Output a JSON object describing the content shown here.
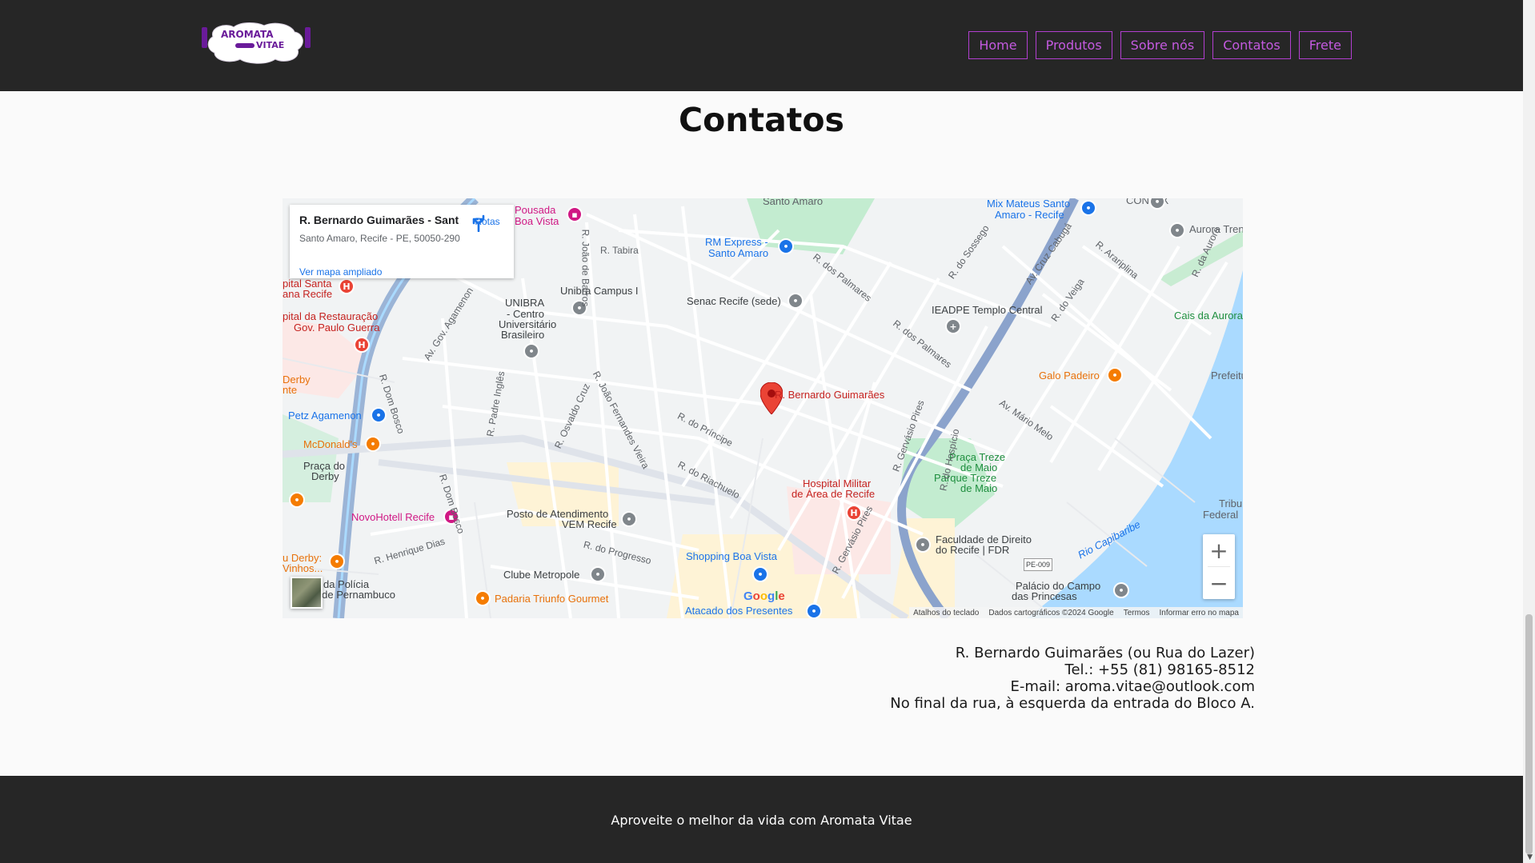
{
  "header": {
    "logo": {
      "line1": "AROMATA",
      "line2": "VITAE"
    },
    "nav": [
      {
        "label": "Home"
      },
      {
        "label": "Produtos"
      },
      {
        "label": "Sobre nós"
      },
      {
        "label": "Contatos"
      },
      {
        "label": "Frete"
      }
    ],
    "colors": {
      "background": "#262626",
      "accent": "#b23fd0"
    }
  },
  "main": {
    "title": "Contatos",
    "map": {
      "info_card": {
        "title": "R. Bernardo Guimarães - Sant...",
        "address": "Santo Amaro, Recife - PE, 50050-290",
        "directions_label": "Rotas",
        "larger_map_link": "Ver mapa ampliado"
      },
      "pin_label": "R. Bernardo Guimarães",
      "labels": [
        "Santo Amaro",
        "Pousada",
        "Boa Vista",
        "R. Tabira",
        "RM Express -",
        "Santo Amaro",
        "Mix Mateus Santo",
        "Amaro - Recife",
        "CONTAX",
        "Aurora Trend",
        "R. do Sossego",
        "Av. Cruz Cabugá",
        "R. Arariplina",
        "R. da Aurora",
        "Cais da Aurora",
        "Prefeitu",
        "Galo Padeiro",
        "IEADPE Templo Central",
        "R. do Veiga",
        "R. dos Palmares",
        "Senac Recife (sede)",
        "Unibra Campus I",
        "UNIBRA",
        "- Centro",
        "Universitário",
        "Brasileiro",
        "R. João de Barros",
        "pital Santa",
        "ana Recife",
        "pital da Restauração",
        "Gov. Paulo Guerra",
        "Derby",
        "nte",
        "Petz Agamenon",
        "McDonald's",
        "Praça do",
        "Derby",
        "NovoHotell Recife",
        "Posto de Atendimento",
        "VEM Recife",
        "Clube Metropole",
        "Shopping Boa Vista",
        "Padaria Triunfo Gourmet",
        "Atacado dos Presentes",
        "Hospital Militar",
        "de Área de Recife",
        "Praça Treze",
        "de Maio",
        "Parque Treze",
        "de Maio",
        "Faculdade de Direito",
        "do Recife | FDR",
        "Palácio do Campo",
        "das Princesas",
        "Rio Capibaribe",
        "Tribu",
        "Federal",
        "R. do Príncipe",
        "R. do Riachuelo",
        "R. do Progresso",
        "R. Henrique Dias",
        "R. Dom Bosco",
        "R. Padre Inglês",
        "R. Osvaldo Cruz",
        "R. João Fernandes Vieira",
        "Av. Gov. Agamenon",
        "R. Gervásio Pires",
        "R. do Hospício",
        "Av. Mário Melo",
        "u Derby:",
        "Vinhos...",
        "gio da Polícia",
        "ar de Pernambuco",
        "PE-009"
      ],
      "attribution": [
        "Atalhos do teclado",
        "Dados cartográficos ©2024 Google",
        "Termos",
        "Informar erro no mapa"
      ],
      "google_logo": "Google",
      "zoom_in": "+",
      "zoom_out": "−"
    },
    "address_lines": [
      "R. Bernardo Guimarães (ou Rua do Lazer)",
      "Tel.: +55 (81) 98165-8512",
      "E-mail: aroma.vitae@outlook.com",
      "No final da rua, à esquerda da entrada do Bloco A."
    ]
  },
  "footer": {
    "text": "Aproveite o melhor da vida com Aromata Vitae"
  }
}
